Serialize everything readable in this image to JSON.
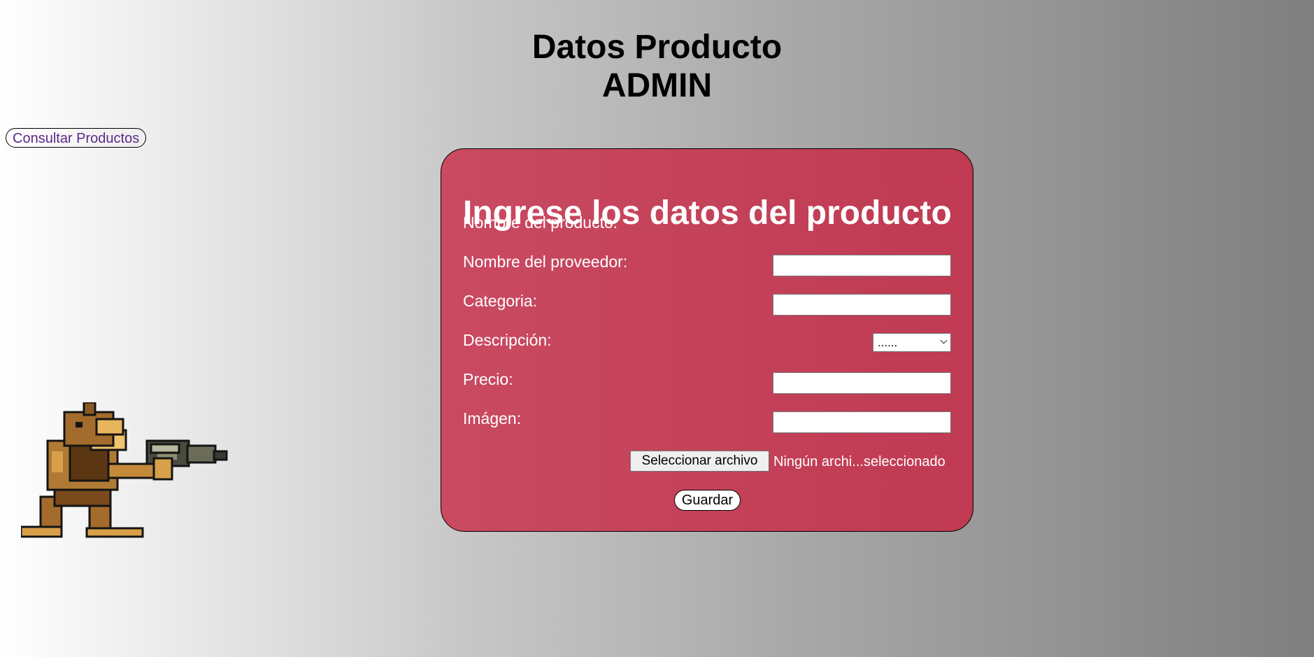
{
  "header": {
    "title_line1": "Datos Producto",
    "title_line2": "ADMIN"
  },
  "nav": {
    "consult_products_label": "Consultar Productos"
  },
  "decoration": {
    "sprite_icon": "pixel-art-soldier-with-bazooka-icon"
  },
  "form": {
    "heading": "Ingrese los datos del producto",
    "fields": {
      "product_name": {
        "label": "Nombre del producto:",
        "value": ""
      },
      "supplier_name": {
        "label": "Nombre del proveedor:",
        "value": ""
      },
      "category": {
        "label": "Categoria:",
        "selected": "......"
      },
      "description": {
        "label": "Descripción:",
        "value": ""
      },
      "price": {
        "label": "Precio:",
        "value": ""
      },
      "image": {
        "label": "Imágen:",
        "button_label": "Seleccionar archivo",
        "status": "Ningún archi...seleccionado"
      }
    },
    "save_label": "Guardar"
  },
  "colors": {
    "card_bg": "#c54259",
    "link": "#5b2a86"
  }
}
